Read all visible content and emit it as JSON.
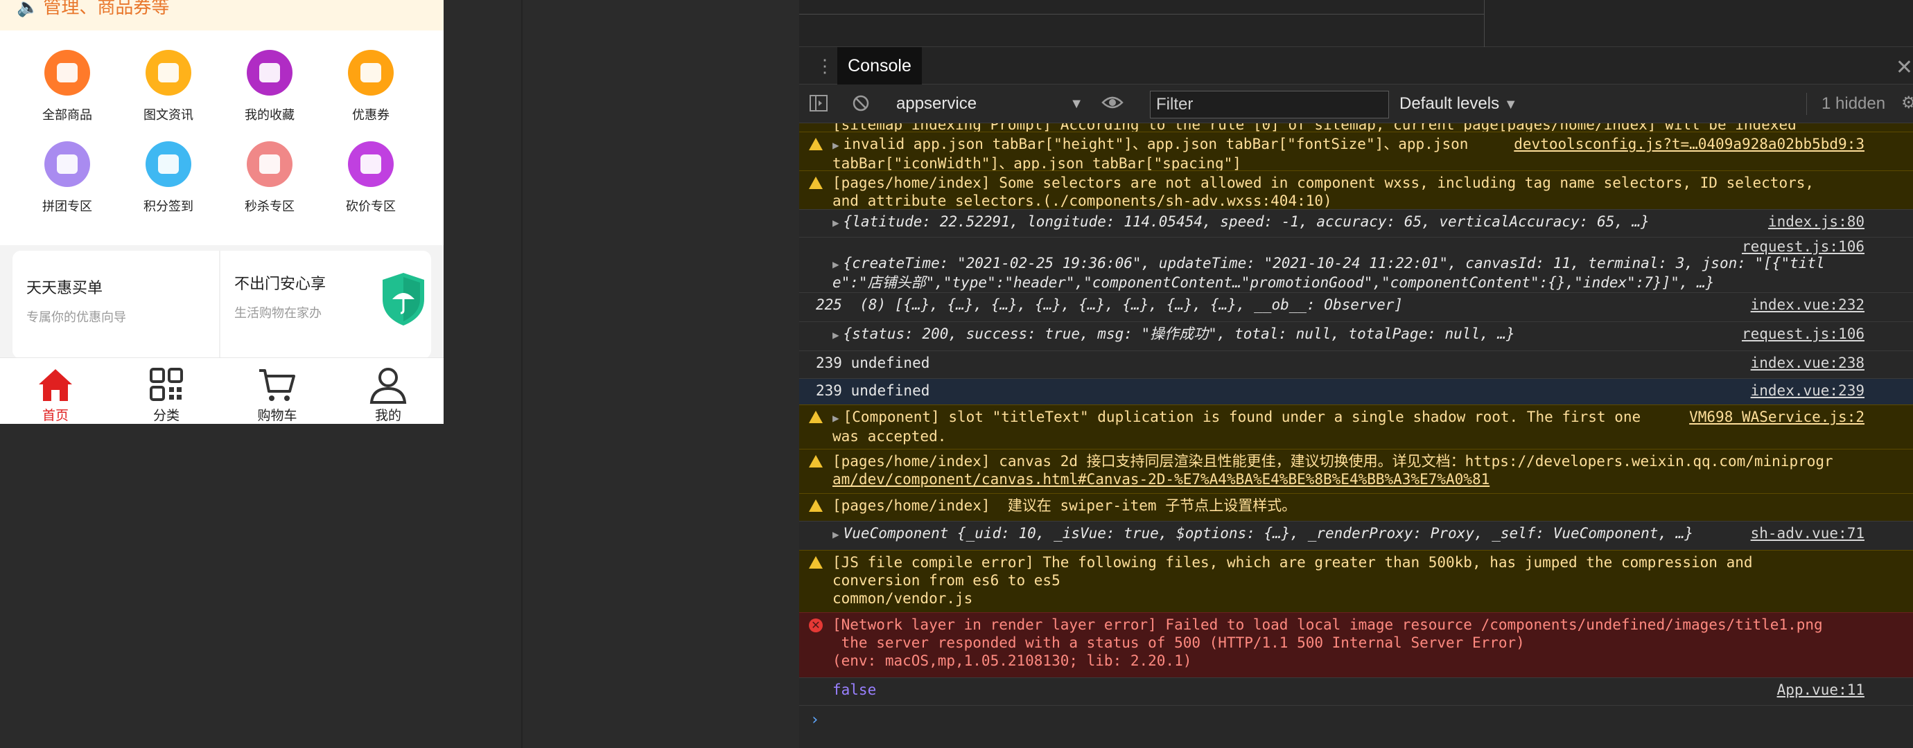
{
  "phone": {
    "notice_text": "管理、商品券等",
    "grid": [
      {
        "label": "全部商品",
        "icon": "shop-icon",
        "color": "#ff7a2a"
      },
      {
        "label": "图文资讯",
        "icon": "article-icon",
        "color": "#ffb21a"
      },
      {
        "label": "我的收藏",
        "icon": "favorite-icon",
        "color": "#b02cc4"
      },
      {
        "label": "优惠券",
        "icon": "coupon-icon",
        "color": "#ffa311"
      },
      {
        "label": "拼团专区",
        "icon": "group-buy-icon",
        "color": "#a98bf0"
      },
      {
        "label": "积分签到",
        "icon": "checkin-icon",
        "color": "#3fb8f2"
      },
      {
        "label": "秒杀专区",
        "icon": "flash-sale-icon",
        "color": "#f08888"
      },
      {
        "label": "砍价专区",
        "icon": "bargain-icon",
        "color": "#c040e0"
      }
    ],
    "card_left": {
      "title": "天天惠买单",
      "subtitle": "专属你的优惠向导"
    },
    "card_right": {
      "title": "不出门安心享",
      "subtitle": "生活购物在家办"
    },
    "tabs": [
      {
        "label": "首页",
        "icon": "home-icon",
        "active": true
      },
      {
        "label": "分类",
        "icon": "category-icon",
        "active": false
      },
      {
        "label": "购物车",
        "icon": "cart-icon",
        "active": false
      },
      {
        "label": "我的",
        "icon": "user-icon",
        "active": false
      }
    ]
  },
  "devtools": {
    "tab_console": "Console",
    "context": "appservice",
    "filter_placeholder": "Filter",
    "levels": "Default levels",
    "hidden": "1 hidden",
    "logs": [
      {
        "type": "warn",
        "text": "[sitemap indexing Prompt] According to the rule [0] of sitemap, current page[pages/home/index] will be indexed"
      },
      {
        "type": "warn",
        "text": "invalid app.json tabBar[\"height\"]、app.json tabBar[\"fontSize\"]、app.json",
        "text2": "tabBar[\"iconWidth\"]、app.json tabBar[\"spacing\"]",
        "source": "devtoolsconfig.js?t=…0409a928a02bb5bd9:3"
      },
      {
        "type": "warn",
        "text": "[pages/home/index] Some selectors are not allowed in component wxss, including tag name selectors, ID selectors,",
        "text2": "and attribute selectors.(./components/sh-adv.wxss:404:10)"
      },
      {
        "type": "log",
        "text": "{latitude: 22.52291, longitude: 114.05454, speed: -1, accuracy: 65, verticalAccuracy: 65, …}",
        "source": "index.js:80"
      },
      {
        "type": "log",
        "text": "{createTime: \"2021-02-25 19:36:06\", updateTime: \"2021-10-24 11:22:01\", canvasId: 11, terminal: 3, json: \"[{\"titl",
        "text2": "e\":\"店铺头部\",\"type\":\"header\",\"componentContent…\"promotionGood\",\"componentContent\":{},\"index\":7}]\", …}",
        "source": "request.js:106"
      },
      {
        "type": "log",
        "text": "225  (8) [{…}, {…}, {…}, {…}, {…}, {…}, {…}, {…}, __ob__: Observer]",
        "source": "index.vue:232"
      },
      {
        "type": "log",
        "text": "{status: 200, success: true, msg: \"操作成功\", total: null, totalPage: null, …}",
        "source": "request.js:106"
      },
      {
        "type": "log",
        "text": "239 undefined",
        "source": "index.vue:238"
      },
      {
        "type": "log",
        "text": "239 undefined",
        "source": "index.vue:239"
      },
      {
        "type": "warn",
        "text": "[Component] slot \"titleText\" duplication is found under a single shadow root. The first one",
        "text2": "was accepted.",
        "source": "VM698 WAService.js:2"
      },
      {
        "type": "warn",
        "text": "[pages/home/index] canvas 2d 接口支持同层渲染且性能更佳，建议切换使用。详见文档：https://developers.weixin.qq.com/miniprogr",
        "text2": "am/dev/component/canvas.html#Canvas-2D-%E7%A4%BA%E4%BE%8B%E4%BB%A3%E7%A0%81"
      },
      {
        "type": "warn",
        "text": "[pages/home/index]  建议在 swiper-item 子节点上设置样式。"
      },
      {
        "type": "log",
        "text": "VueComponent {_uid: 10, _isVue: true, $options: {…}, _renderProxy: Proxy, _self: VueComponent, …}",
        "source": "sh-adv.vue:71"
      },
      {
        "type": "warn",
        "text": "[JS file compile error] The following files, which are greater than 500kb, has jumped the compression and",
        "text2": "conversion from es6 to es5",
        "text3": "common/vendor.js"
      },
      {
        "type": "error",
        "text": "[Network layer in render layer error] Failed to load local image resource /components/undefined/images/title1.png",
        "text2": " the server responded with a status of 500 (HTTP/1.1 500 Internal Server Error)",
        "text3": "(env: macOS,mp,1.05.2108130; lib: 2.20.1)"
      },
      {
        "type": "log",
        "text": "false",
        "source": "App.vue:11"
      }
    ]
  }
}
